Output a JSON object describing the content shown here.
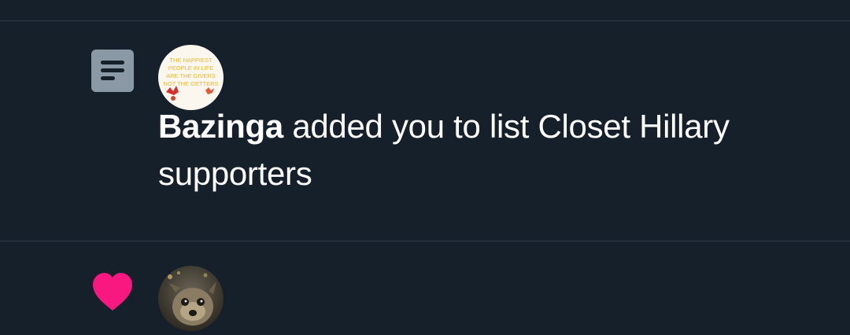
{
  "notifications": [
    {
      "type_icon": "list-icon",
      "avatar_icon": "quote-image-avatar",
      "avatar_text": "THE HAPPIEST PEOPLE IN LIFE ARE THE GIVERS NOT THE GETTERS",
      "actor": "Bazinga",
      "message": "added you to list Closet Hillary supporters"
    },
    {
      "type_icon": "heart-icon",
      "avatar_icon": "dog-photo-avatar"
    }
  ],
  "colors": {
    "background": "#15202b",
    "divider": "#2f3d4c",
    "list_icon": "#8b98a5",
    "heart": "#f91880",
    "text": "#ffffff"
  }
}
